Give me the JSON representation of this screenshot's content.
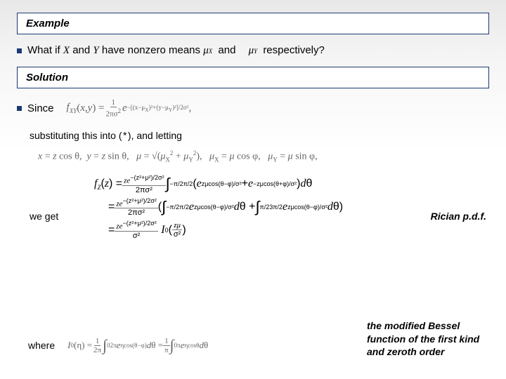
{
  "headings": {
    "example": "Example",
    "solution": "Solution"
  },
  "q": {
    "prefix": "What if ",
    "x": "X",
    "mid1": " and ",
    "y": "Y",
    "mid2": " have nonzero means ",
    "mu_x": "μ",
    "mu_x_sub": "X",
    "and": "and",
    "mu_y": "μ",
    "mu_y_sub": "Y",
    "suffix": "respectively?"
  },
  "since": {
    "label": "Since",
    "eq": "f_{XY}(x,y) = (1 / 2πσ²) e^{−[(x−μ_X)² + (y−μ_Y)²] / 2σ²} ,"
  },
  "sub_line": {
    "t1": "substituting this into (",
    "star": "*",
    "t2": "), and letting"
  },
  "defs": "x = z cos θ,  y = z sin θ,  μ = √(μ_X² + μ_Y²),  μ_X = μ cos φ,  μ_Y = μ sin φ,",
  "we_get": "we get",
  "fz": {
    "l1": "f_Z(z) = (z e^{−(z²+μ²)/2σ²} / 2πσ²) ∫_{−π/2}^{π/2} (e^{zμ cos(θ−φ)/σ²} + e^{−zμ cos(θ+φ)/σ²}) dθ",
    "l2": "= (z e^{−(z²+μ²)/2σ²} / 2πσ²) ( ∫_{−π/2}^{π/2} e^{zμ cos(θ−φ)/σ²} dθ + ∫_{π/2}^{3π/2} e^{zμ cos(θ−φ)/σ²} dθ )",
    "l3": "= (z e^{−(z²+μ²)/2σ²} / σ²) I₀( zμ / σ² )"
  },
  "rician": "Rician p.d.f.",
  "where": "where",
  "i0": "I₀(η) = (1/2π) ∫₀^{2π} e^{η cos(θ−φ)} dθ = (1/π) ∫₀^{π} e^{η cos θ} dθ",
  "bessel": "the modified Bessel function of the first kind and zeroth order"
}
